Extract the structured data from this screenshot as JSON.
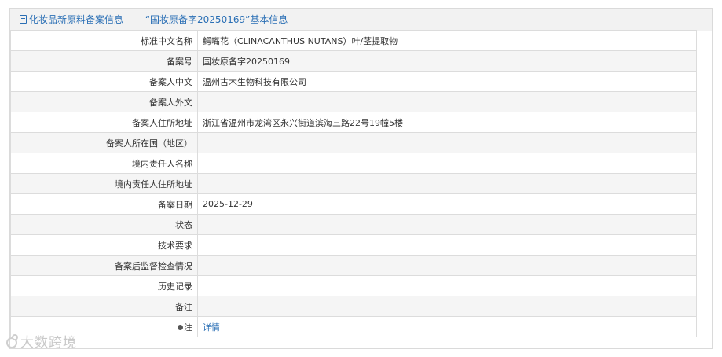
{
  "header": {
    "icon": "document-icon",
    "title": "化妆品新原料备案信息 ——“国妆原备字20250169”基本信息"
  },
  "rows": [
    {
      "label": "标准中文名称",
      "value": "鳄嘴花（CLINACANTHUS NUTANS）叶/茎提取物"
    },
    {
      "label": "备案号",
      "value": "国妆原备字20250169"
    },
    {
      "label": "备案人中文",
      "value": "温州古木生物科技有限公司"
    },
    {
      "label": "备案人外文",
      "value": ""
    },
    {
      "label": "备案人住所地址",
      "value": "浙江省温州市龙湾区永兴街道滨海三路22号19幢5楼"
    },
    {
      "label": "备案人所在国（地区）",
      "value": ""
    },
    {
      "label": "境内责任人名称",
      "value": ""
    },
    {
      "label": "境内责任人住所地址",
      "value": ""
    },
    {
      "label": "备案日期",
      "value": "2025-12-29"
    },
    {
      "label": "状态",
      "value": ""
    },
    {
      "label": "技术要求",
      "value": ""
    },
    {
      "label": "备案后监督检查情况",
      "value": ""
    },
    {
      "label": "历史记录",
      "value": ""
    },
    {
      "label": "备注",
      "value": ""
    }
  ],
  "note_row": {
    "icon": "dot-icon",
    "label": "注",
    "link_text": "详情"
  },
  "watermark": {
    "text": "大数跨境"
  },
  "colors": {
    "accent": "#2a6fb5",
    "header_bg": "#f2f2f2",
    "row_alt_bg": "#f5f5f5",
    "border": "#dcdcdc"
  }
}
